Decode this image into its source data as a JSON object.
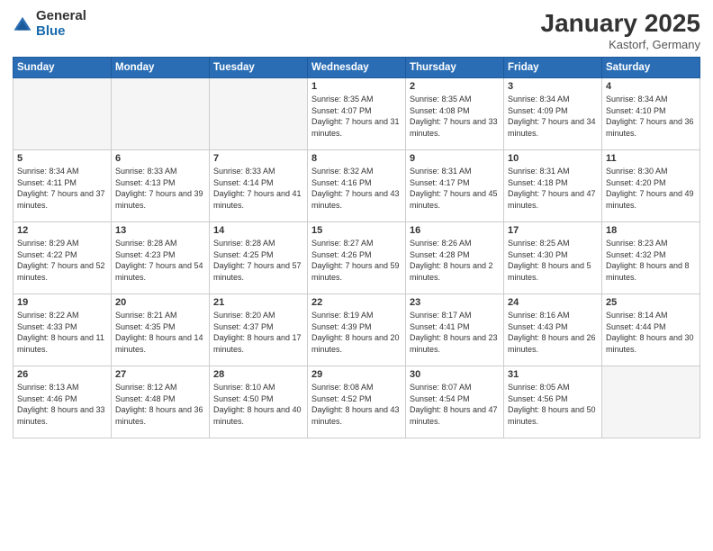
{
  "logo": {
    "general": "General",
    "blue": "Blue"
  },
  "title": "January 2025",
  "subtitle": "Kastorf, Germany",
  "days_of_week": [
    "Sunday",
    "Monday",
    "Tuesday",
    "Wednesday",
    "Thursday",
    "Friday",
    "Saturday"
  ],
  "weeks": [
    [
      {
        "day": "",
        "empty": true
      },
      {
        "day": "",
        "empty": true
      },
      {
        "day": "",
        "empty": true
      },
      {
        "day": "1",
        "sunrise": "Sunrise: 8:35 AM",
        "sunset": "Sunset: 4:07 PM",
        "daylight": "Daylight: 7 hours and 31 minutes."
      },
      {
        "day": "2",
        "sunrise": "Sunrise: 8:35 AM",
        "sunset": "Sunset: 4:08 PM",
        "daylight": "Daylight: 7 hours and 33 minutes."
      },
      {
        "day": "3",
        "sunrise": "Sunrise: 8:34 AM",
        "sunset": "Sunset: 4:09 PM",
        "daylight": "Daylight: 7 hours and 34 minutes."
      },
      {
        "day": "4",
        "sunrise": "Sunrise: 8:34 AM",
        "sunset": "Sunset: 4:10 PM",
        "daylight": "Daylight: 7 hours and 36 minutes."
      }
    ],
    [
      {
        "day": "5",
        "sunrise": "Sunrise: 8:34 AM",
        "sunset": "Sunset: 4:11 PM",
        "daylight": "Daylight: 7 hours and 37 minutes."
      },
      {
        "day": "6",
        "sunrise": "Sunrise: 8:33 AM",
        "sunset": "Sunset: 4:13 PM",
        "daylight": "Daylight: 7 hours and 39 minutes."
      },
      {
        "day": "7",
        "sunrise": "Sunrise: 8:33 AM",
        "sunset": "Sunset: 4:14 PM",
        "daylight": "Daylight: 7 hours and 41 minutes."
      },
      {
        "day": "8",
        "sunrise": "Sunrise: 8:32 AM",
        "sunset": "Sunset: 4:16 PM",
        "daylight": "Daylight: 7 hours and 43 minutes."
      },
      {
        "day": "9",
        "sunrise": "Sunrise: 8:31 AM",
        "sunset": "Sunset: 4:17 PM",
        "daylight": "Daylight: 7 hours and 45 minutes."
      },
      {
        "day": "10",
        "sunrise": "Sunrise: 8:31 AM",
        "sunset": "Sunset: 4:18 PM",
        "daylight": "Daylight: 7 hours and 47 minutes."
      },
      {
        "day": "11",
        "sunrise": "Sunrise: 8:30 AM",
        "sunset": "Sunset: 4:20 PM",
        "daylight": "Daylight: 7 hours and 49 minutes."
      }
    ],
    [
      {
        "day": "12",
        "sunrise": "Sunrise: 8:29 AM",
        "sunset": "Sunset: 4:22 PM",
        "daylight": "Daylight: 7 hours and 52 minutes."
      },
      {
        "day": "13",
        "sunrise": "Sunrise: 8:28 AM",
        "sunset": "Sunset: 4:23 PM",
        "daylight": "Daylight: 7 hours and 54 minutes."
      },
      {
        "day": "14",
        "sunrise": "Sunrise: 8:28 AM",
        "sunset": "Sunset: 4:25 PM",
        "daylight": "Daylight: 7 hours and 57 minutes."
      },
      {
        "day": "15",
        "sunrise": "Sunrise: 8:27 AM",
        "sunset": "Sunset: 4:26 PM",
        "daylight": "Daylight: 7 hours and 59 minutes."
      },
      {
        "day": "16",
        "sunrise": "Sunrise: 8:26 AM",
        "sunset": "Sunset: 4:28 PM",
        "daylight": "Daylight: 8 hours and 2 minutes."
      },
      {
        "day": "17",
        "sunrise": "Sunrise: 8:25 AM",
        "sunset": "Sunset: 4:30 PM",
        "daylight": "Daylight: 8 hours and 5 minutes."
      },
      {
        "day": "18",
        "sunrise": "Sunrise: 8:23 AM",
        "sunset": "Sunset: 4:32 PM",
        "daylight": "Daylight: 8 hours and 8 minutes."
      }
    ],
    [
      {
        "day": "19",
        "sunrise": "Sunrise: 8:22 AM",
        "sunset": "Sunset: 4:33 PM",
        "daylight": "Daylight: 8 hours and 11 minutes."
      },
      {
        "day": "20",
        "sunrise": "Sunrise: 8:21 AM",
        "sunset": "Sunset: 4:35 PM",
        "daylight": "Daylight: 8 hours and 14 minutes."
      },
      {
        "day": "21",
        "sunrise": "Sunrise: 8:20 AM",
        "sunset": "Sunset: 4:37 PM",
        "daylight": "Daylight: 8 hours and 17 minutes."
      },
      {
        "day": "22",
        "sunrise": "Sunrise: 8:19 AM",
        "sunset": "Sunset: 4:39 PM",
        "daylight": "Daylight: 8 hours and 20 minutes."
      },
      {
        "day": "23",
        "sunrise": "Sunrise: 8:17 AM",
        "sunset": "Sunset: 4:41 PM",
        "daylight": "Daylight: 8 hours and 23 minutes."
      },
      {
        "day": "24",
        "sunrise": "Sunrise: 8:16 AM",
        "sunset": "Sunset: 4:43 PM",
        "daylight": "Daylight: 8 hours and 26 minutes."
      },
      {
        "day": "25",
        "sunrise": "Sunrise: 8:14 AM",
        "sunset": "Sunset: 4:44 PM",
        "daylight": "Daylight: 8 hours and 30 minutes."
      }
    ],
    [
      {
        "day": "26",
        "sunrise": "Sunrise: 8:13 AM",
        "sunset": "Sunset: 4:46 PM",
        "daylight": "Daylight: 8 hours and 33 minutes."
      },
      {
        "day": "27",
        "sunrise": "Sunrise: 8:12 AM",
        "sunset": "Sunset: 4:48 PM",
        "daylight": "Daylight: 8 hours and 36 minutes."
      },
      {
        "day": "28",
        "sunrise": "Sunrise: 8:10 AM",
        "sunset": "Sunset: 4:50 PM",
        "daylight": "Daylight: 8 hours and 40 minutes."
      },
      {
        "day": "29",
        "sunrise": "Sunrise: 8:08 AM",
        "sunset": "Sunset: 4:52 PM",
        "daylight": "Daylight: 8 hours and 43 minutes."
      },
      {
        "day": "30",
        "sunrise": "Sunrise: 8:07 AM",
        "sunset": "Sunset: 4:54 PM",
        "daylight": "Daylight: 8 hours and 47 minutes."
      },
      {
        "day": "31",
        "sunrise": "Sunrise: 8:05 AM",
        "sunset": "Sunset: 4:56 PM",
        "daylight": "Daylight: 8 hours and 50 minutes."
      },
      {
        "day": "",
        "empty": true
      }
    ]
  ]
}
